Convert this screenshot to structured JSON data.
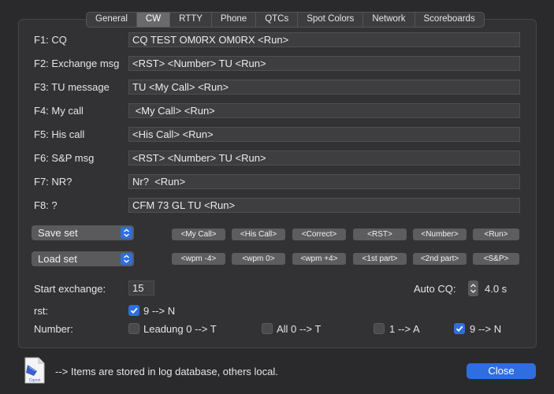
{
  "tabs": [
    "General",
    "CW",
    "RTTY",
    "Phone",
    "QTCs",
    "Spot Colors",
    "Network",
    "Scoreboards"
  ],
  "active_tab": "CW",
  "messages": [
    {
      "label": "F1: CQ",
      "value": "CQ TEST OM0RX OM0RX <Run>"
    },
    {
      "label": "F2: Exchange msg",
      "value": "<RST> <Number> TU <Run>"
    },
    {
      "label": "F3: TU message",
      "value": "TU <My Call> <Run>"
    },
    {
      "label": "F4: My call",
      "value": " <My Call> <Run>"
    },
    {
      "label": "F5: His call",
      "value": "<His Call> <Run>"
    },
    {
      "label": "F6: S&P msg",
      "value": "<RST> <Number> TU <Run>"
    },
    {
      "label": "F7: NR?",
      "value": "Nr?  <Run>"
    },
    {
      "label": "F8: ?",
      "value": "CFM 73 GL TU <Run>"
    }
  ],
  "sets": {
    "save_label": "Save set",
    "load_label": "Load set"
  },
  "macro_row1": [
    "<My Call>",
    "<His Call>",
    "<Correct>",
    "<RST>",
    "<Number>",
    "<Run>"
  ],
  "macro_row2": [
    "<wpm -4>",
    "<wpm 0>",
    "<wpm +4>",
    "<1st part>",
    "<2nd part>",
    "<S&P>"
  ],
  "options": {
    "start_exchange_label": "Start exchange:",
    "start_exchange_value": "15",
    "auto_cq_label": "Auto CQ:",
    "auto_cq_value": "4.0 s",
    "rst_label": "rst:",
    "rst_option": "9 --> N",
    "rst_checked": true,
    "number_label": "Number:",
    "number_options": [
      {
        "label": "Leadung 0 --> T",
        "checked": false
      },
      {
        "label": "All 0 --> T",
        "checked": false
      },
      {
        "label": "1 --> A",
        "checked": false
      },
      {
        "label": "9 --> N",
        "checked": true
      }
    ]
  },
  "footer": {
    "note": "--> Items are stored in log database, others local.",
    "close_label": "Close",
    "icon_text": "Cqsrzt"
  },
  "colors": {
    "accent": "#2f6ee0",
    "panel": "#323234",
    "background": "#2a2a2c"
  }
}
